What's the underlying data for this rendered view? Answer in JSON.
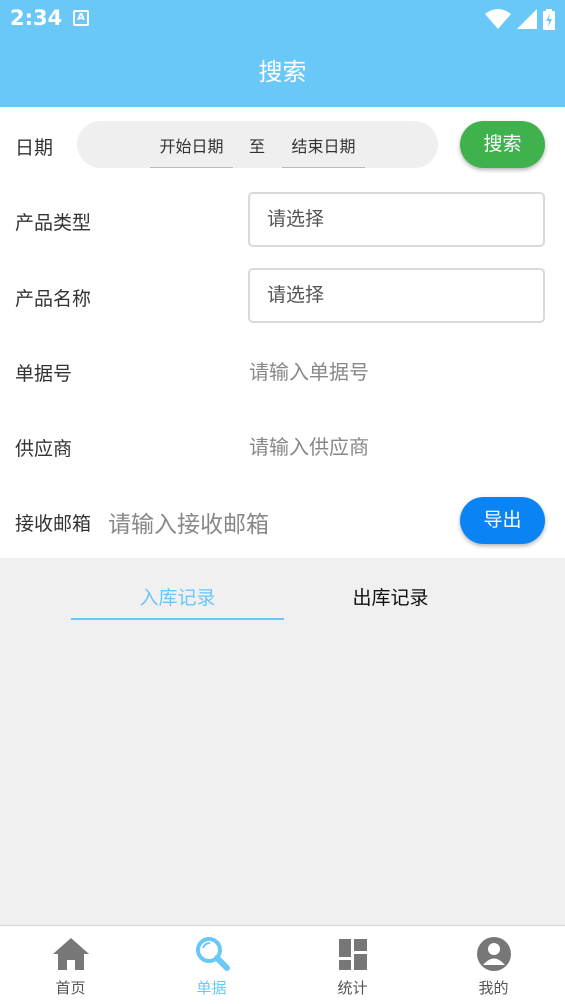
{
  "status_bar": {
    "time": "2:34",
    "a_icon": "A"
  },
  "header": {
    "title": "搜索"
  },
  "form": {
    "date_label": "日期",
    "date_start": "开始日期",
    "date_sep": "至",
    "date_end": "结束日期",
    "search_button": "搜索",
    "product_type_label": "产品类型",
    "product_type_value": "请选择",
    "product_name_label": "产品名称",
    "product_name_value": "请选择",
    "doc_no_label": "单据号",
    "doc_no_placeholder": "请输入单据号",
    "supplier_label": "供应商",
    "supplier_placeholder": "请输入供应商",
    "email_label": "接收邮箱",
    "email_placeholder": "请输入接收邮箱",
    "export_button": "导出"
  },
  "tabs": [
    {
      "label": "入库记录",
      "active": true
    },
    {
      "label": "出库记录",
      "active": false
    }
  ],
  "bottom_nav": [
    {
      "label": "首页",
      "icon": "home-icon",
      "active": false
    },
    {
      "label": "单据",
      "icon": "search-icon",
      "active": true
    },
    {
      "label": "统计",
      "icon": "dashboard-icon",
      "active": false
    },
    {
      "label": "我的",
      "icon": "user-icon",
      "active": false
    }
  ],
  "colors": {
    "primary": "#6ac8f8",
    "search_button": "#3fb24e",
    "export_button": "#0a84f5",
    "background": "#f0f0f0"
  }
}
